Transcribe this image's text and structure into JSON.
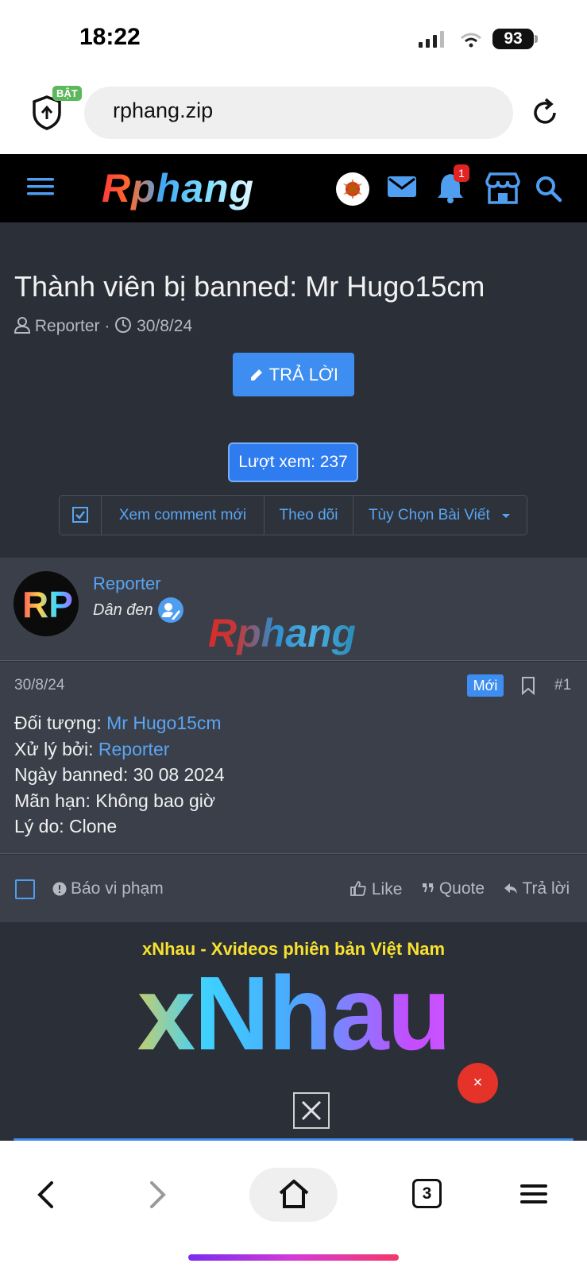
{
  "status": {
    "time": "18:22",
    "battery": "93"
  },
  "browser": {
    "url": "rphang.zip",
    "shield_badge": "BẬT",
    "tab_count": "3"
  },
  "site": {
    "logo": "Rphang",
    "notif_count": "1"
  },
  "thread": {
    "title": "Thành viên bị banned: Mr Hugo15cm",
    "author": "Reporter",
    "date": "30/8/24",
    "reply_label": "TRẢ LỜI",
    "views_label": "Lượt xem: 237",
    "toolbar": {
      "new_comments": "Xem comment mới",
      "follow": "Theo dõi",
      "options": "Tùy Chọn Bài Viết"
    }
  },
  "post": {
    "avatar_text": "RP",
    "username": "Reporter",
    "role": "Dân đen",
    "watermark": "Rphang",
    "date": "30/8/24",
    "new_badge": "Mới",
    "number": "#1",
    "lines": {
      "target_label": "Đối tượng: ",
      "target_value": "Mr Hugo15cm",
      "handler_label": "Xử lý bởi: ",
      "handler_value": "Reporter",
      "ban_date": "Ngày banned: 30 08 2024",
      "expiry": "Mãn hạn: Không bao giờ",
      "reason": "Lý do: Clone"
    },
    "actions": {
      "report": "Báo vi phạm",
      "like": "Like",
      "quote": "Quote",
      "reply": "Trả lời"
    }
  },
  "ad": {
    "title": "xNhau - Xvideos phiên bản Việt Nam",
    "logo": "xNhau",
    "close_symbol": "×"
  },
  "colors": {
    "accent": "#3d8ef0",
    "link": "#5aa5f2",
    "bg_dark": "#2b2f38",
    "post_bg": "#3a3f4a",
    "ad_title": "#f7e12f"
  }
}
